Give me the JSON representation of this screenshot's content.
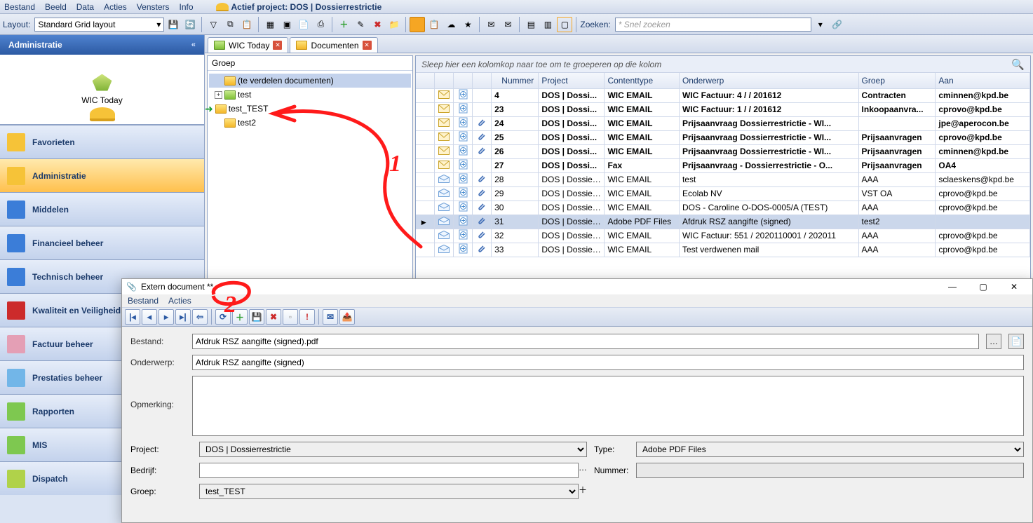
{
  "menu": {
    "items": [
      "Bestand",
      "Beeld",
      "Data",
      "Acties",
      "Vensters",
      "Info"
    ],
    "project_label": "Actief project:",
    "project_value": "DOS | Dossierrestrictie"
  },
  "layout": {
    "label": "Layout:",
    "value": "Standard Grid layout",
    "search_label": "Zoeken:",
    "search_placeholder": "* Snel zoeken"
  },
  "sidebar": {
    "title": "Administratie",
    "top_label": "WIC Today",
    "items": [
      "Favorieten",
      "Administratie",
      "Middelen",
      "Financieel beheer",
      "Technisch beheer",
      "Kwaliteit en Veiligheid",
      "Factuur beheer",
      "Prestaties beheer",
      "Rapporten",
      "MIS",
      "Dispatch"
    ],
    "active": 1
  },
  "tabs": [
    {
      "label": "WIC Today"
    },
    {
      "label": "Documenten"
    }
  ],
  "tree": {
    "header": "Groep",
    "nodes": [
      "(te verdelen documenten)",
      "test",
      "test_TEST",
      "test2"
    ]
  },
  "grid": {
    "group_hint": "Sleep hier een kolomkop naar toe om te groeperen op die kolom",
    "columns": [
      "",
      "",
      "",
      "Nummer",
      "Project",
      "Contenttype",
      "Onderwerp",
      "Groep",
      "Aan"
    ],
    "rows": [
      {
        "b": true,
        "n": 4,
        "p": "DOS | Dossi...",
        "c": "WIC EMAIL",
        "o": "WIC Factuur: 4 /  / 201612",
        "g": "Contracten",
        "a": "cminnen@kpd.be",
        "att": false
      },
      {
        "b": true,
        "n": 23,
        "p": "DOS | Dossi...",
        "c": "WIC EMAIL",
        "o": "WIC Factuur: 1 /  / 201612",
        "g": "Inkoopaanvra...",
        "a": "cprovo@kpd.be",
        "att": false
      },
      {
        "b": true,
        "n": 24,
        "p": "DOS | Dossi...",
        "c": "WIC EMAIL",
        "o": "Prijsaanvraag Dossierrestrictie - WI...",
        "g": "",
        "a": "jpe@aperocon.be",
        "att": true
      },
      {
        "b": true,
        "n": 25,
        "p": "DOS | Dossi...",
        "c": "WIC EMAIL",
        "o": "Prijsaanvraag Dossierrestrictie - WI...",
        "g": "Prijsaanvragen",
        "a": "cprovo@kpd.be",
        "att": true
      },
      {
        "b": true,
        "n": 26,
        "p": "DOS | Dossi...",
        "c": "WIC EMAIL",
        "o": "Prijsaanvraag Dossierrestrictie - WI...",
        "g": "Prijsaanvragen",
        "a": "cminnen@kpd.be",
        "att": true
      },
      {
        "b": true,
        "n": 27,
        "p": "DOS | Dossi...",
        "c": "Fax",
        "o": "Prijsaanvraag - Dossierrestrictie - O...",
        "g": "Prijsaanvragen",
        "a": "OA4",
        "att": false
      },
      {
        "b": false,
        "n": 28,
        "p": "DOS | Dossierr...",
        "c": "WIC EMAIL",
        "o": "test",
        "g": "AAA",
        "a": "sclaeskens@kpd.be",
        "att": true
      },
      {
        "b": false,
        "n": 29,
        "p": "DOS | Dossierr...",
        "c": "WIC EMAIL",
        "o": "Ecolab NV",
        "g": "VST OA",
        "a": "cprovo@kpd.be",
        "att": true
      },
      {
        "b": false,
        "n": 30,
        "p": "DOS | Dossierr...",
        "c": "WIC EMAIL",
        "o": "DOS - Caroline O-DOS-0005/A (TEST)",
        "g": "AAA",
        "a": "cprovo@kpd.be",
        "att": true
      },
      {
        "b": false,
        "sel": true,
        "n": 31,
        "p": "DOS | Dossierr...",
        "c": "Adobe PDF Files",
        "o": "Afdruk RSZ aangifte (signed)",
        "g": "test2",
        "a": "",
        "att": true
      },
      {
        "b": false,
        "n": 32,
        "p": "DOS | Dossierr...",
        "c": "WIC EMAIL",
        "o": "WIC Factuur: 551 / 2020110001 / 202011",
        "g": "AAA",
        "a": "cprovo@kpd.be",
        "att": true
      },
      {
        "b": false,
        "n": 33,
        "p": "DOS | Dossierr...",
        "c": "WIC EMAIL",
        "o": "Test verdwenen mail",
        "g": "AAA",
        "a": "cprovo@kpd.be",
        "att": true
      }
    ]
  },
  "dialog": {
    "title": "Extern document **",
    "menu": [
      "Bestand",
      "Acties"
    ],
    "labels": {
      "bestand": "Bestand:",
      "onderwerp": "Onderwerp:",
      "opmerking": "Opmerking:",
      "project": "Project:",
      "type": "Type:",
      "bedrijf": "Bedrijf:",
      "nummer": "Nummer:",
      "groep": "Groep:"
    },
    "values": {
      "bestand": "Afdruk RSZ aangifte (signed).pdf",
      "onderwerp": "Afdruk RSZ aangifte (signed)",
      "opmerking": "",
      "project": "DOS | Dossierrestrictie",
      "type": "Adobe PDF Files",
      "bedrijf": "",
      "nummer": "",
      "groep": "test_TEST"
    }
  },
  "annot": {
    "one": "1",
    "two": "2"
  }
}
